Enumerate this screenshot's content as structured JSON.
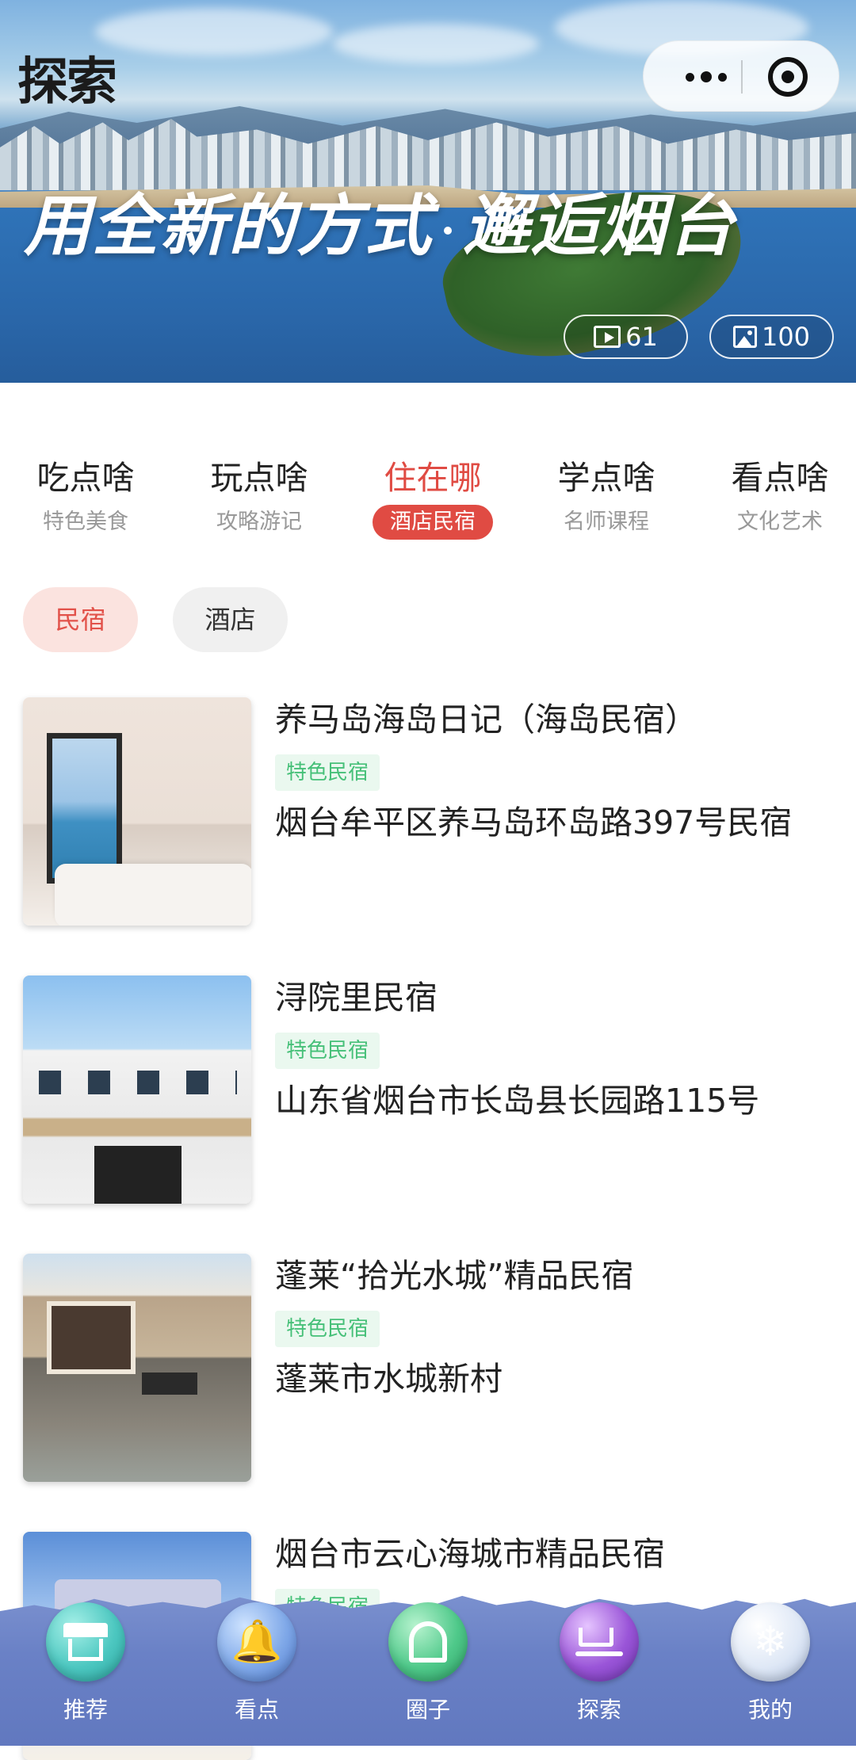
{
  "header": {
    "title": "探索",
    "slogan_left": "用全新的方式",
    "slogan_right": "邂逅烟台",
    "video_count": "61",
    "photo_count": "100"
  },
  "tabs": [
    {
      "title": "吃点啥",
      "sub": "特色美食"
    },
    {
      "title": "玩点啥",
      "sub": "攻略游记"
    },
    {
      "title": "住在哪",
      "sub": "酒店民宿"
    },
    {
      "title": "学点啥",
      "sub": "名师课程"
    },
    {
      "title": "看点啥",
      "sub": "文化艺术"
    }
  ],
  "active_tab": 2,
  "filters": {
    "homestay": "民宿",
    "hotel": "酒店"
  },
  "listings": [
    {
      "name": "养马岛海岛日记（海岛民宿）",
      "tag": "特色民宿",
      "address": "烟台牟平区养马岛环岛路397号民宿"
    },
    {
      "name": "浔院里民宿",
      "tag": "特色民宿",
      "address": "山东省烟台市长岛县长园路115号"
    },
    {
      "name": "蓬莱“拾光水城”精品民宿",
      "tag": "特色民宿",
      "address": "蓬莱市水城新村"
    },
    {
      "name": "烟台市云心海城市精品民宿",
      "tag": "特色民宿",
      "address": ""
    }
  ],
  "bottom_nav": {
    "recommend": "推荐",
    "sights": "看点",
    "circle": "圈子",
    "explore": "探索",
    "mine": "我的"
  },
  "colors": {
    "accent": "#e04b43",
    "tag_green": "#46c078",
    "tabbar_blue": "#6a81c6"
  }
}
